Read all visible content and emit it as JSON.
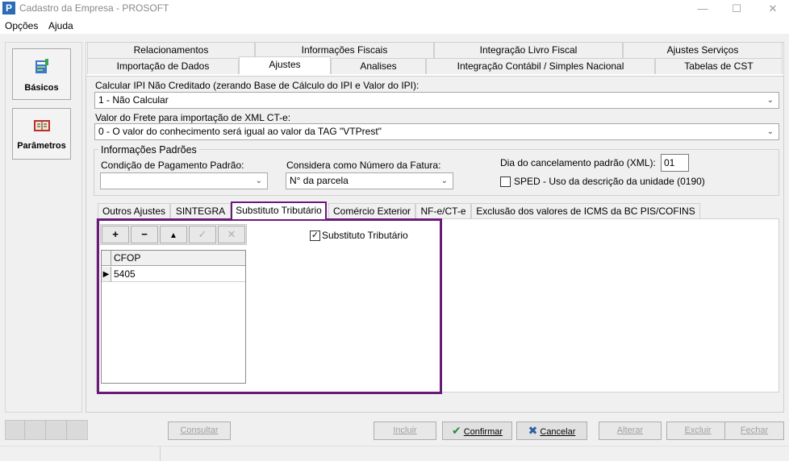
{
  "window": {
    "title": "Cadastro da Empresa - PROSOFT",
    "icon_letter": "P",
    "controls": [
      "—",
      "☐",
      "✕"
    ]
  },
  "menu": [
    "Opções",
    "Ajuda"
  ],
  "sidebar": {
    "items": [
      {
        "label": "Básicos",
        "icon": "basicos-icon"
      },
      {
        "label": "Parâmetros",
        "icon": "parametros-icon"
      }
    ]
  },
  "tabs_row1": [
    "Relacionamentos",
    "Informações Fiscais",
    "Integração Livro Fiscal",
    "Ajustes Serviços"
  ],
  "tabs_row2": [
    "Importação de Dados",
    "Ajustes",
    "Analises",
    "Integração Contábil / Simples Nacional",
    "Tabelas de CST"
  ],
  "active_tab": "Ajustes",
  "form": {
    "ipi_label": "Calcular IPI Não Creditado (zerando Base de Cálculo do IPI e Valor do IPI):",
    "ipi_value": "1 - Não Calcular",
    "frete_label": "Valor do Frete para importação de XML CT-e:",
    "frete_value": "0 - O valor do conhecimento será igual ao valor da TAG \"VTPrest\"",
    "group_title": "Informações Padrões",
    "condicao_label": "Condição de Pagamento Padrão:",
    "condicao_value": "",
    "fatura_label": "Considera como Número da Fatura:",
    "fatura_value": "N° da parcela",
    "cancelamento_label": "Dia do cancelamento padrão (XML):",
    "cancelamento_value": "01",
    "sped_label": "SPED - Uso da descrição da unidade (0190)",
    "sped_checked": false
  },
  "inner_tabs": [
    "Outros Ajustes",
    "SINTEGRA",
    "Substituto Tributário",
    "Comércio Exterior",
    "NF-e/CT-e",
    "Exclusão dos valores de ICMS da BC PIS/COFINS"
  ],
  "active_inner_tab": "Substituto Tributário",
  "toolbar": {
    "add": "+",
    "remove": "−",
    "up": "▲",
    "confirm": "✓",
    "cancel": "✕"
  },
  "substituto": {
    "checkbox_label": "Substituto Tributário",
    "checked": true
  },
  "grid": {
    "columns": [
      "CFOP"
    ],
    "rows": [
      [
        "5405"
      ]
    ]
  },
  "buttons": {
    "consultar": "Consultar",
    "incluir": "Incluir",
    "confirmar": "Confirmar",
    "cancelar": "Cancelar",
    "alterar": "Alterar",
    "excluir": "Excluir",
    "fechar": "Fechar"
  },
  "colors": {
    "highlight_border": "#6b1a7a",
    "confirm_check": "#2e8b3a",
    "cancel_x": "#2b5fa8"
  }
}
